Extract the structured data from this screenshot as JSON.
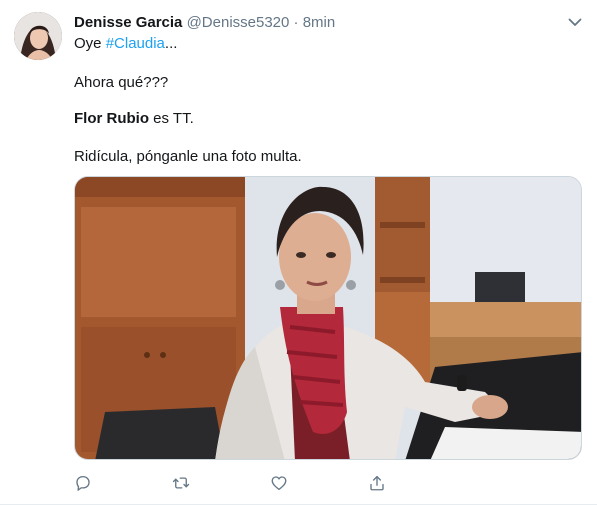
{
  "tweet": {
    "author": {
      "name": "Denisse Garcia",
      "handle": "@Denisse5320"
    },
    "separator": "·",
    "time": "8min",
    "text": {
      "line1_prefix": "Oye ",
      "hashtag": "#Claudia",
      "line1_suffix": "...",
      "line2": "Ahora qué???",
      "line3_bold": "Flor Rubio",
      "line3_rest": " es TT.",
      "line4": "Ridícula, pónganle una foto multa."
    },
    "actions": [
      "reply-icon",
      "retweet-icon",
      "like-icon",
      "share-icon"
    ],
    "colors": {
      "link": "#1da1f2",
      "muted": "#657786",
      "text": "#14171a"
    }
  }
}
